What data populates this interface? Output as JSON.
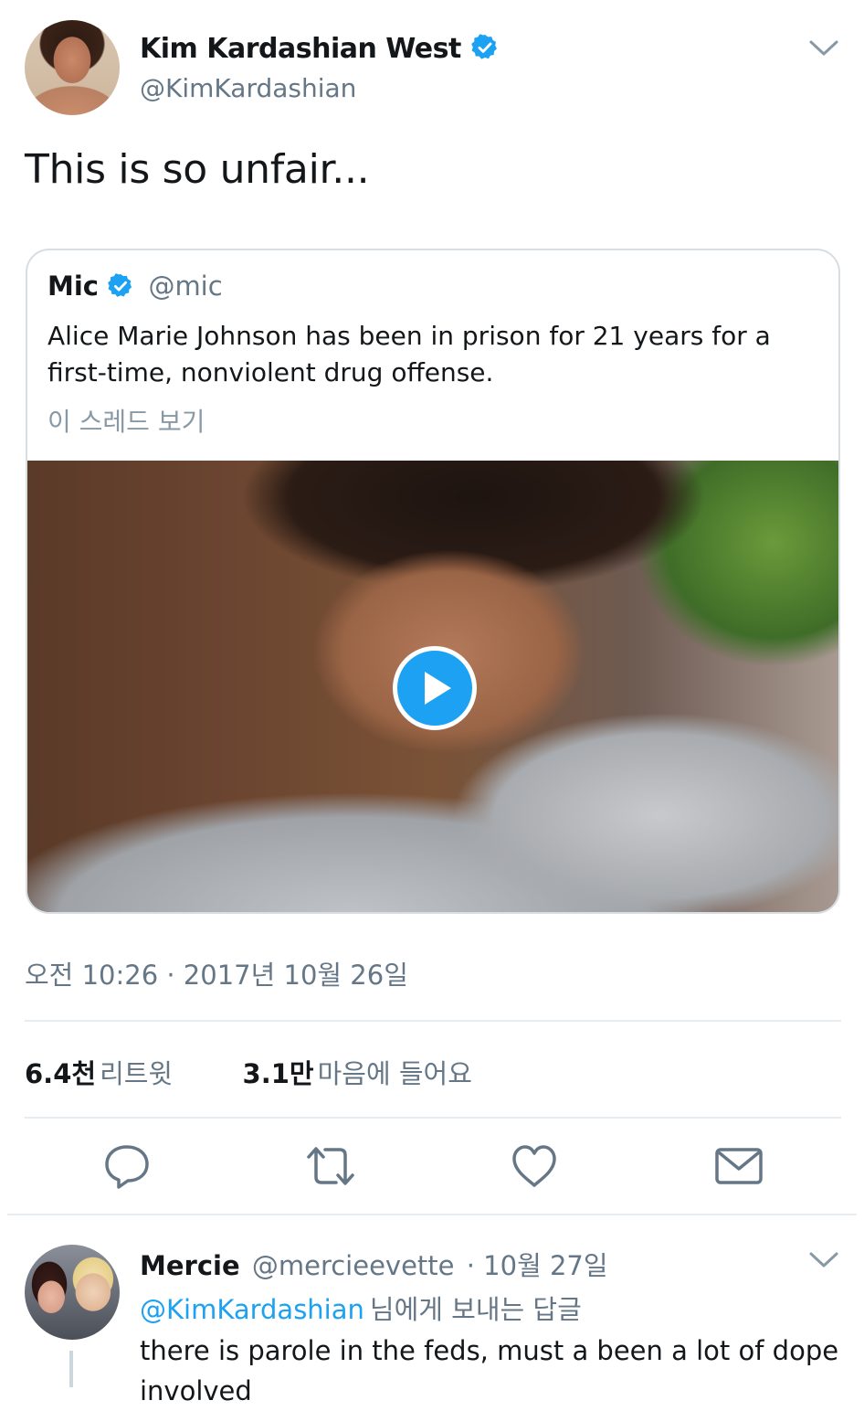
{
  "tweet": {
    "author_name": "Kim Kardashian West",
    "author_handle": "@KimKardashian",
    "text": "This is so unfair...",
    "timestamp": "오전 10:26 · 2017년 10월 26일",
    "stats": {
      "retweets_count": "6.4천",
      "retweets_label": "리트윗",
      "likes_count": "3.1만",
      "likes_label": "마음에 들어요"
    }
  },
  "quote": {
    "author_name": "Mic",
    "author_handle": "@mic",
    "text": "Alice Marie Johnson has been in prison for 21 years for a first-time, nonviolent drug offense.",
    "thread_link": "이 스레드 보기"
  },
  "actions": {
    "reply_icon": "reply-icon",
    "retweet_icon": "retweet-icon",
    "like_icon": "heart-icon",
    "dm_icon": "envelope-icon"
  },
  "reply": {
    "author_name": "Mercie",
    "author_handle": "@mercieevette",
    "date": "· 10월 27일",
    "replying_to_mention": "@KimKardashian",
    "replying_to_rest": "님에게 보내는 답글",
    "text": "there is parole in the feds, must a been a lot of dope involved"
  },
  "colors": {
    "accent": "#1da1f2",
    "secondary_text": "#657786",
    "divider": "#e6ecf0"
  }
}
